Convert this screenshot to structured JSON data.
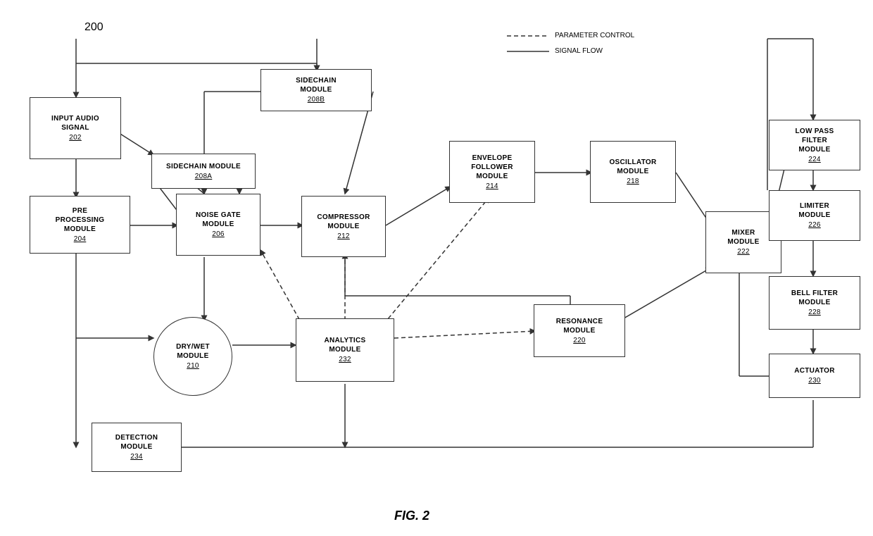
{
  "diagram_number": "200",
  "fig_label": "FIG. 2",
  "legend": {
    "param_control": "PARAMETER CONTROL",
    "signal_flow": "SIGNAL FLOW"
  },
  "modules": {
    "input_audio": {
      "label": "INPUT AUDIO\nSIGNAL",
      "ref": "202"
    },
    "pre_processing": {
      "label": "PRE\nPROCESSING\nMODULE",
      "ref": "204"
    },
    "sidechain_208a": {
      "label": "SIDECHAIN MODULE",
      "ref": "208A"
    },
    "sidechain_208b": {
      "label": "SIDECHAIN\nMODULE",
      "ref": "208B"
    },
    "noise_gate": {
      "label": "NOISE GATE\nMODULE",
      "ref": "206"
    },
    "compressor": {
      "label": "COMPRESSOR\nMODULE",
      "ref": "212"
    },
    "drywet": {
      "label": "DRY/WET\nMODULE",
      "ref": "210"
    },
    "analytics": {
      "label": "ANALYTICS\nMODULE",
      "ref": "232"
    },
    "envelope_follower": {
      "label": "ENVELOPE\nFOLLOWER\nMODULE",
      "ref": "214"
    },
    "oscillator": {
      "label": "OSCILLATOR\nMODULE",
      "ref": "218"
    },
    "resonance": {
      "label": "RESONANCE\nMODULE",
      "ref": "220"
    },
    "mixer": {
      "label": "MIXER\nMODULE",
      "ref": "222"
    },
    "low_pass_filter": {
      "label": "LOW PASS\nFILTER\nMODULE",
      "ref": "224"
    },
    "limiter": {
      "label": "LIMITER\nMODULE",
      "ref": "226"
    },
    "bell_filter": {
      "label": "BELL FILTER\nMODULE",
      "ref": "228"
    },
    "actuator": {
      "label": "ACTUATOR",
      "ref": "230"
    },
    "detection": {
      "label": "DETECTION\nMODULE",
      "ref": "234"
    }
  }
}
